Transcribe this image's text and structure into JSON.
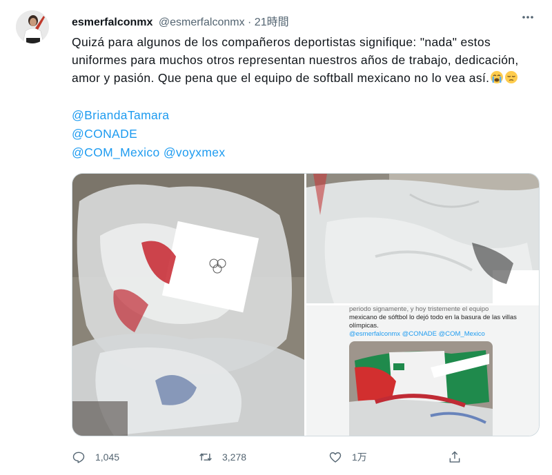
{
  "tweet": {
    "display_name": "esmerfalconmx",
    "handle": "@esmerfalconmx",
    "separator": "·",
    "time": "21時間",
    "text": "Quizá para algunos de los compañeros deportistas signifique: \"nada\" estos uniformes para muchos otros representan nuestros años de trabajo, dedicación, amor y pasión. Que pena que el equipo de softball mexicano no lo vea así.",
    "emojis": [
      "crying-face-emoji",
      "pensive-face-emoji"
    ],
    "mentions": [
      "@BriandaTamara",
      "@CONADE",
      "@COM_Mexico @voyxmex"
    ]
  },
  "media": {
    "embedded_screenshot": {
      "text_top": "periodo signamente, y hoy tristemente el equipo",
      "text_body": "mexicano de sóftbol lo dejó todo en la basura de las villas olímpicas.",
      "handles": "@esmerfalconmx @CONADE @COM_Mexico"
    }
  },
  "actions": {
    "replies": "1,045",
    "retweets": "3,278",
    "likes": "1万"
  },
  "icons": [
    "more-icon",
    "reply-icon",
    "retweet-icon",
    "like-icon",
    "share-icon"
  ],
  "colors": {
    "accent": "#1d9bf0",
    "secondary_text": "#536471",
    "text": "#0f1419"
  }
}
